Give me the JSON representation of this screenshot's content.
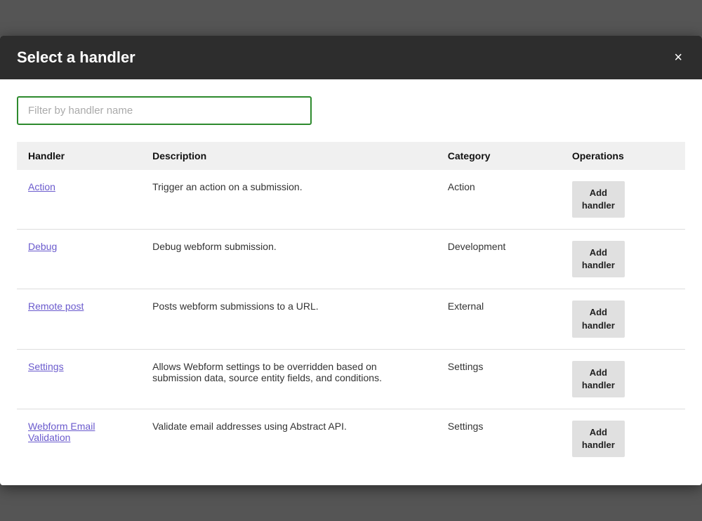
{
  "modal": {
    "title": "Select a handler",
    "close_label": "×"
  },
  "filter": {
    "placeholder": "Filter by handler name"
  },
  "table": {
    "headers": {
      "handler": "Handler",
      "description": "Description",
      "category": "Category",
      "operations": "Operations"
    },
    "rows": [
      {
        "handler": "Action",
        "description": "Trigger an action on a submission.",
        "category": "Action",
        "button_label": "Add\nhandler"
      },
      {
        "handler": "Debug",
        "description": "Debug webform submission.",
        "category": "Development",
        "button_label": "Add\nhandler"
      },
      {
        "handler": "Remote post",
        "description": "Posts webform submissions to a URL.",
        "category": "External",
        "button_label": "Add\nhandler"
      },
      {
        "handler": "Settings",
        "description": "Allows Webform settings to be overridden based on submission data, source entity fields, and conditions.",
        "category": "Settings",
        "button_label": "Add\nhandler"
      },
      {
        "handler": "Webform Email Validation",
        "description": "Validate email addresses using Abstract API.",
        "category": "Settings",
        "button_label": "Add\nhandler"
      }
    ]
  }
}
